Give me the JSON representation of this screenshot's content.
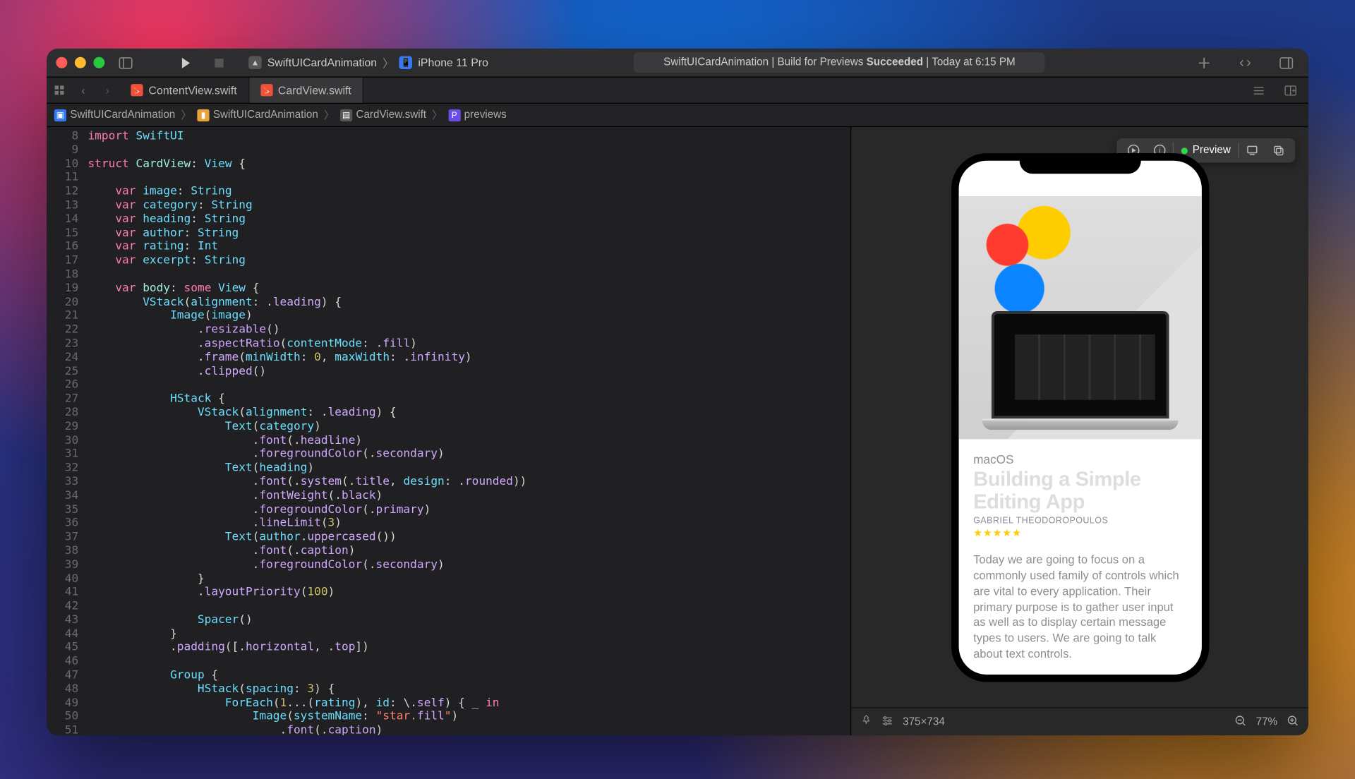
{
  "titlebar": {
    "scheme_project": "SwiftUICardAnimation",
    "scheme_device": "iPhone 11 Pro",
    "status_prefix": "SwiftUICardAnimation | Build for Previews",
    "status_bold": "Succeeded",
    "status_suffix": "| Today at 6:15 PM"
  },
  "tabs": [
    {
      "label": "ContentView.swift",
      "active": false
    },
    {
      "label": "CardView.swift",
      "active": true
    }
  ],
  "breadcrumb": {
    "project": "SwiftUICardAnimation",
    "folder": "SwiftUICardAnimation",
    "file": "CardView.swift",
    "symbol": "previews"
  },
  "editor": {
    "first_line": 8,
    "last_line": 51,
    "lines": [
      "import SwiftUI",
      "",
      "struct CardView: View {",
      "",
      "    var image: String",
      "    var category: String",
      "    var heading: String",
      "    var author: String",
      "    var rating: Int",
      "    var excerpt: String",
      "",
      "    var body: some View {",
      "        VStack(alignment: .leading) {",
      "            Image(image)",
      "                .resizable()",
      "                .aspectRatio(contentMode: .fill)",
      "                .frame(minWidth: 0, maxWidth: .infinity)",
      "                .clipped()",
      "",
      "            HStack {",
      "                VStack(alignment: .leading) {",
      "                    Text(category)",
      "                        .font(.headline)",
      "                        .foregroundColor(.secondary)",
      "                    Text(heading)",
      "                        .font(.system(.title, design: .rounded))",
      "                        .fontWeight(.black)",
      "                        .foregroundColor(.primary)",
      "                        .lineLimit(3)",
      "                    Text(author.uppercased())",
      "                        .font(.caption)",
      "                        .foregroundColor(.secondary)",
      "                }",
      "                .layoutPriority(100)",
      "",
      "                Spacer()",
      "            }",
      "            .padding([.horizontal, .top])",
      "",
      "            Group {",
      "                HStack(spacing: 3) {",
      "                    ForEach(1...(rating), id: \\.self) { _ in",
      "                        Image(systemName: \"star.fill\")",
      "                            .font(.caption)"
    ]
  },
  "preview": {
    "toolbar_label": "Preview",
    "card": {
      "category": "macOS",
      "heading": "Building a Simple Editing App",
      "author": "GABRIEL THEODOROPOULOS",
      "rating": 5,
      "excerpt": "Today we are going to focus on a commonly used family of controls which are vital to every application. Their primary purpose is to gather user input as well as to display certain message types to users. We are going to talk about text controls."
    },
    "footer": {
      "dimensions": "375×734",
      "zoom": "77%"
    }
  }
}
